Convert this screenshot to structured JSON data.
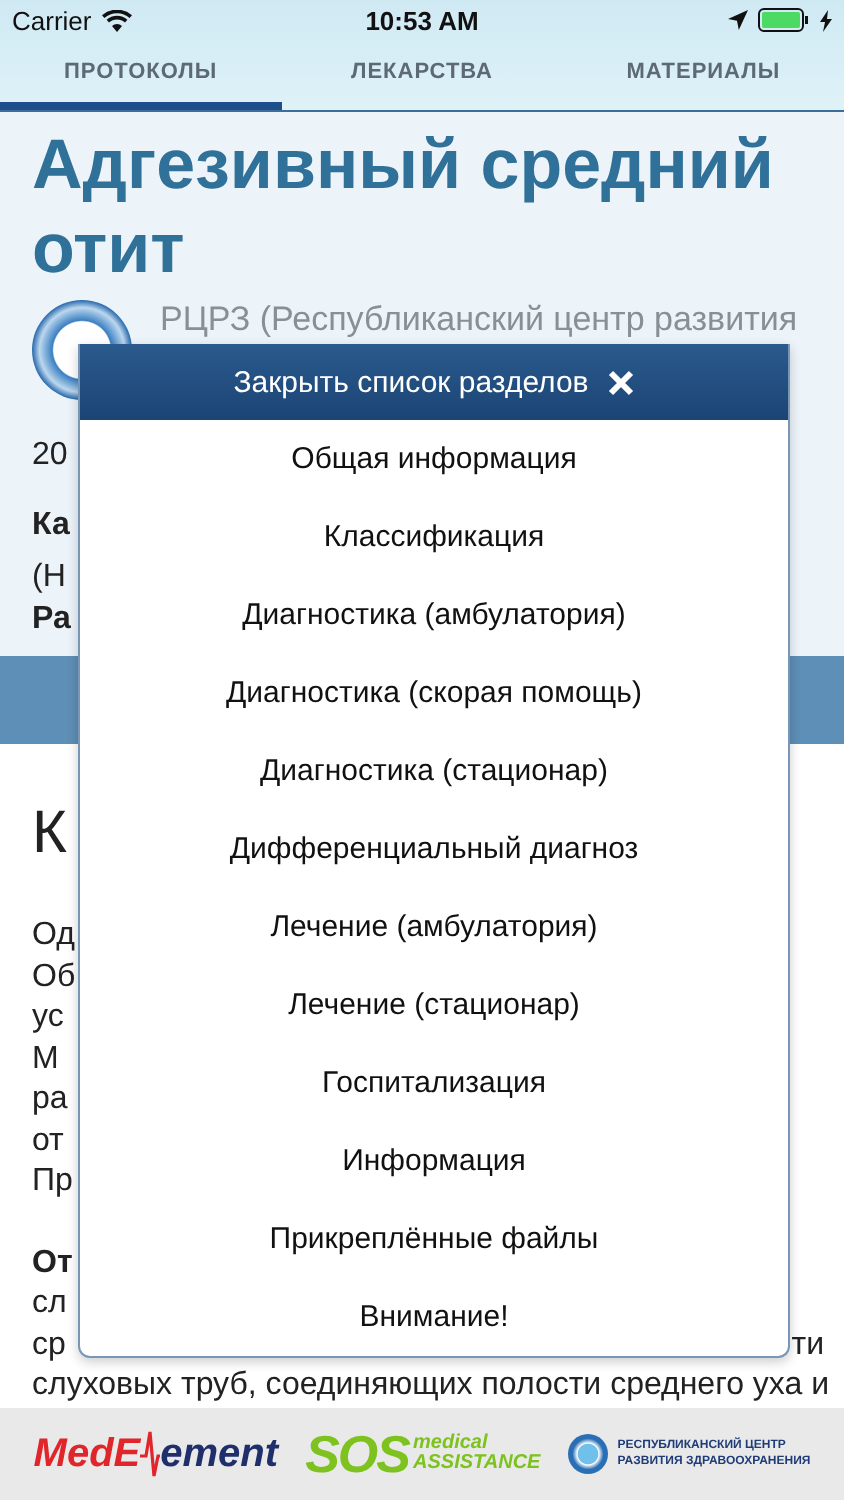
{
  "status_bar": {
    "carrier": "Carrier",
    "time": "10:53 AM"
  },
  "tabs": [
    {
      "label": "ПРОТОКОЛЫ",
      "selected": true
    },
    {
      "label": "ЛЕКАРСТВА",
      "selected": false
    },
    {
      "label": "МАТЕРИАЛЫ",
      "selected": false
    }
  ],
  "article": {
    "title": "Адгезивный средний отит",
    "source": "РЦРЗ (Республиканский центр развития",
    "meta_lines": [
      {
        "text": "20",
        "bold": false
      },
      {
        "text": "Ка",
        "bold": true
      },
      {
        "text": "(Н",
        "bold": false
      },
      {
        "text": "Ра",
        "bold": true
      }
    ],
    "section_heading": "К",
    "paragraphs": [
      {
        "lines": [
          {
            "text": "Од",
            "bold": false
          },
          {
            "text": "Об",
            "bold": false
          },
          {
            "text": "ус",
            "bold": false
          },
          {
            "text": "М",
            "bold": false
          },
          {
            "text": "ра",
            "bold": false
          },
          {
            "text": "от",
            "bold": false
          },
          {
            "text": "Пр",
            "bold": false
          }
        ]
      },
      {
        "lines": [
          {
            "text": "От",
            "bold": true
          },
          {
            "text": "сл",
            "bold": false
          },
          {
            "text": "ср",
            "end": "ти",
            "bold": false
          },
          {
            "text": "слуховых труб, соединяющих полости среднего уха и",
            "bold": false
          }
        ]
      }
    ]
  },
  "sections_menu": {
    "close_label": "Закрыть список разделов",
    "items": [
      "Общая информация",
      "Классификация",
      "Диагностика (амбулатория)",
      "Диагностика (скорая помощь)",
      "Диагностика (стационар)",
      "Дифференциальный диагноз",
      "Лечение (амбулатория)",
      "Лечение (стационар)",
      "Госпитализация",
      "Информация",
      "Прикреплённые файлы",
      "Внимание!"
    ]
  },
  "footer": {
    "medelement": {
      "start": "MedE",
      "end": "ement"
    },
    "sos": {
      "main": "SOS",
      "top": "medical",
      "bottom": "ASSISTANCE"
    },
    "center": {
      "line_1": "РЕСПУБЛИКАНСКИЙ ЦЕНТР",
      "line_2": "РАЗВИТИЯ ЗДРАВООХРАНЕНИЯ"
    }
  }
}
